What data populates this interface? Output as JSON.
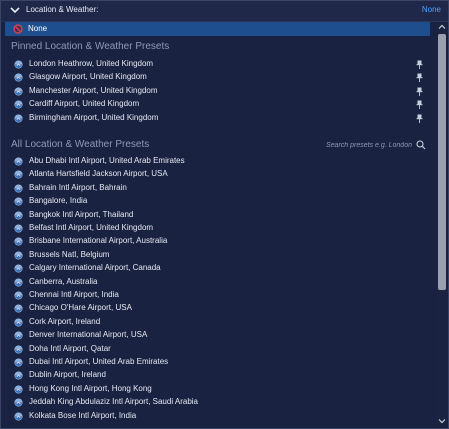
{
  "header": {
    "title": "Location & Weather:",
    "value": "None"
  },
  "selected": {
    "label": "None"
  },
  "pinned": {
    "title": "Pinned Location & Weather Presets",
    "items": [
      "London Heathrow, United Kingdom",
      "Glasgow Airport, United Kingdom",
      "Manchester Airport, United Kingdom",
      "Cardiff Airport, United Kingdom",
      "Birmingham Airport, United Kingdom"
    ]
  },
  "all": {
    "title": "All Location & Weather Presets",
    "search_placeholder": "Search presets e.g. London",
    "items": [
      "Abu Dhabi Intl Airport, United Arab Emirates",
      "Atlanta Hartsfield Jackson Airport, USA",
      "Bahrain Intl Airport, Bahrain",
      "Bangalore, India",
      "Bangkok Intl Airport, Thailand",
      "Belfast Intl Airport, United Kingdom",
      "Brisbane International Airport, Australia",
      "Brussels Natl, Belgium",
      "Calgary International Airport, Canada",
      "Canberra, Australia",
      "Chennai Intl Airport, India",
      "Chicago O'Hare Airport, USA",
      "Cork Airport, Ireland",
      "Denver International Airport, USA",
      "Doha Intl Airport, Qatar",
      "Dubai Intl Airport, United Arab Emirates",
      "Dublin Airport, Ireland",
      "Hong Kong Intl Airport, Hong Kong",
      "Jeddah King Abdulaziz Intl Airport, Saudi Arabia",
      "Kolkata Bose Intl Airport, India"
    ]
  },
  "icons": {
    "expand": "chevron-down-icon",
    "none": "no-weather-icon",
    "preset": "weather-globe-icon",
    "pin": "pin-icon",
    "search": "search-icon"
  },
  "colors": {
    "accent": "#4aa3ff",
    "selection": "#1f4e8f",
    "background": "#1a2241",
    "section_title": "#8f99b6"
  }
}
